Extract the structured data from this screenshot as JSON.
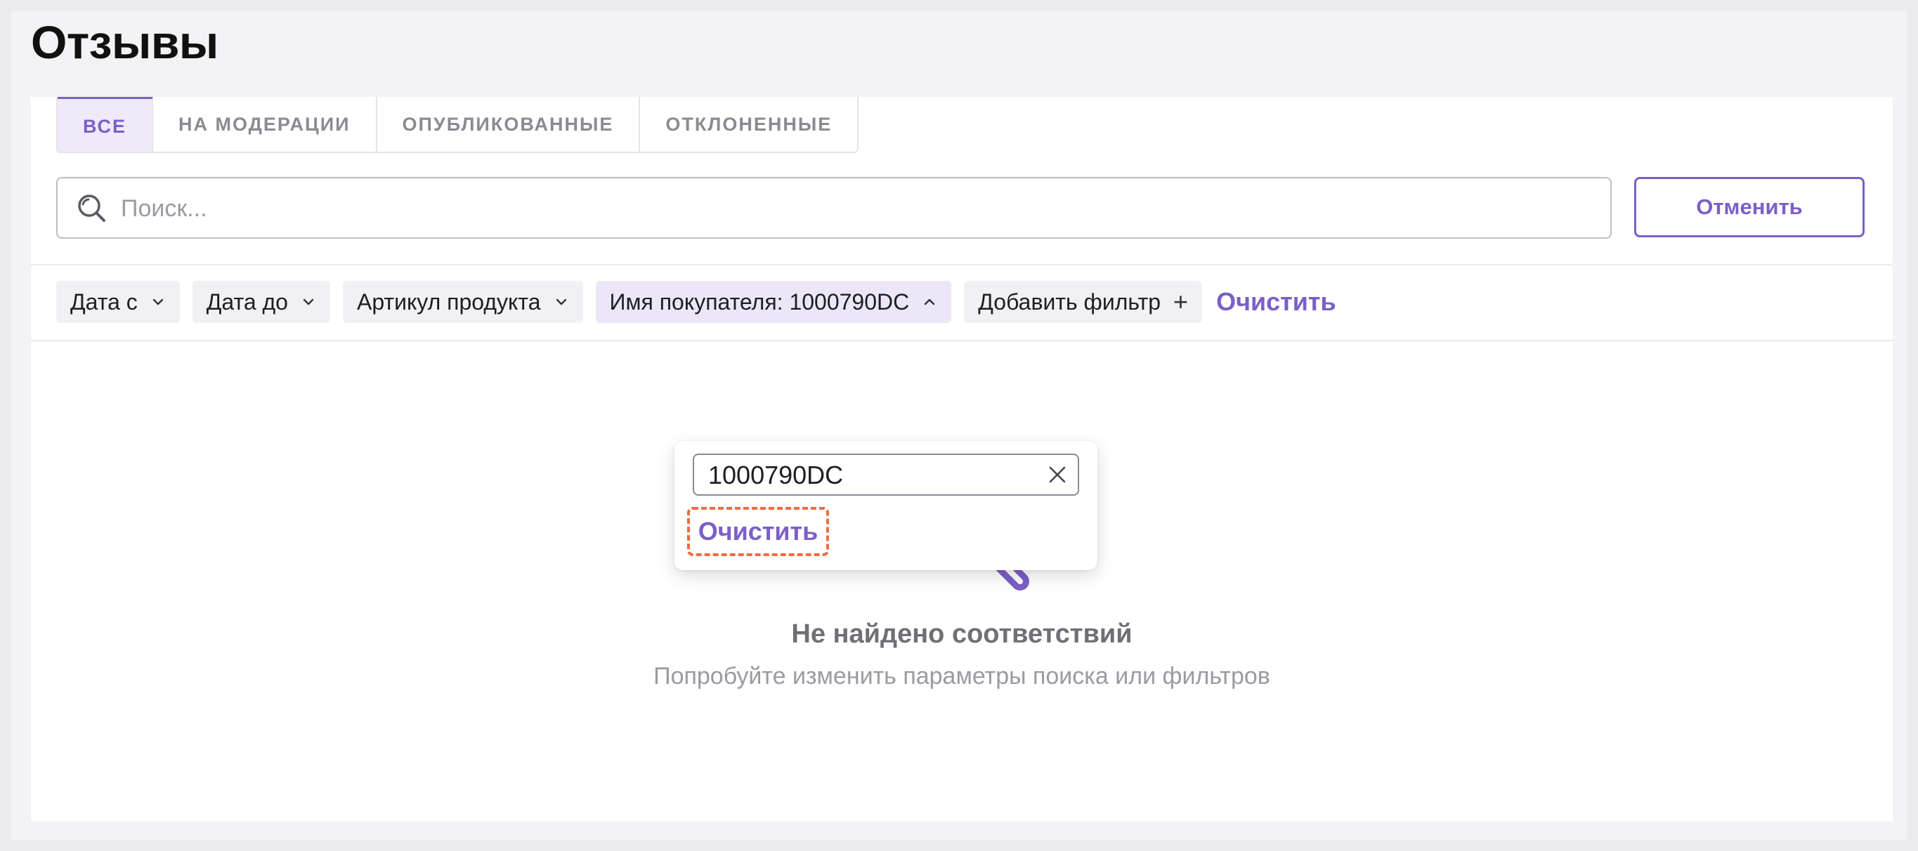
{
  "page": {
    "title": "Отзывы"
  },
  "tabs": [
    {
      "label": "ВСЕ",
      "active": true
    },
    {
      "label": "НА МОДЕРАЦИИ",
      "active": false
    },
    {
      "label": "ОПУБЛИКОВАННЫЕ",
      "active": false
    },
    {
      "label": "ОТКЛОНЕННЫЕ",
      "active": false
    }
  ],
  "search": {
    "placeholder": "Поиск...",
    "value": "",
    "icon": "search-icon"
  },
  "cancel_button": {
    "label": "Отменить"
  },
  "filters": {
    "chips": [
      {
        "label": "Дата с",
        "icon": "chevron-down-icon"
      },
      {
        "label": "Дата до",
        "icon": "chevron-down-icon"
      },
      {
        "label": "Артикул продукта",
        "icon": "chevron-down-icon"
      },
      {
        "label": "Имя покупателя: 1000790DC",
        "icon": "chevron-up-icon"
      },
      {
        "label": "Добавить фильтр",
        "icon": "plus-icon",
        "symbol": "+"
      }
    ],
    "clear_label": "Очистить"
  },
  "popover": {
    "input_value": "1000790DC",
    "clear_label": "Очистить"
  },
  "empty_state": {
    "title": "Не найдено соответствий",
    "subtitle": "Попробуйте изменить параметры поиска или фильтров",
    "icon": "search-icon"
  },
  "colors": {
    "accent": "#7b5fc7",
    "highlight": "#f06a43",
    "text": "#1e1e22",
    "muted": "#9a9aa2"
  }
}
